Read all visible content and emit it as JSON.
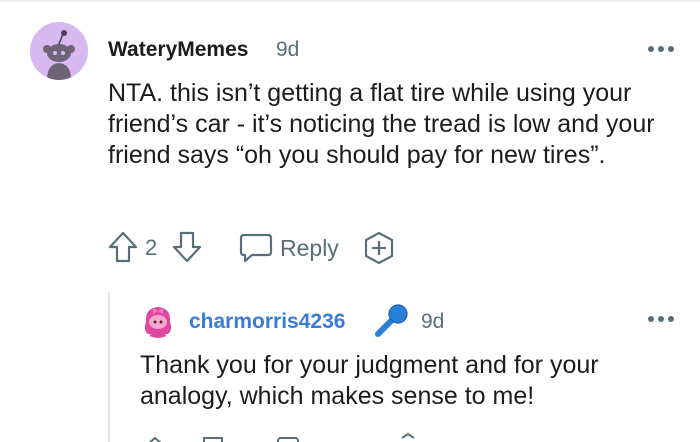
{
  "colors": {
    "text": "#1c1c1c",
    "meta": "#576f76",
    "reply_author": "#3a7bd5",
    "avatar_bg": "#d7b8ef",
    "flair_blue": "#2a7fd9"
  },
  "comment": {
    "author": "WateryMemes",
    "age": "9d",
    "avatar_icon": "snoo-avatar-icon",
    "text": "NTA. this isn’t getting a flat tire while using your friend’s car - it’s noticing the tread is low and your friend says “oh you should pay for new tires”.",
    "score": "2",
    "reply_label": "Reply"
  },
  "reply": {
    "author": "charmorris4236",
    "age": "9d",
    "avatar_icon": "pink-snoo-avatar-icon",
    "flair_icon": "microphone-icon",
    "text": "Thank you for your judgment and for your analogy, which makes sense to me!"
  }
}
